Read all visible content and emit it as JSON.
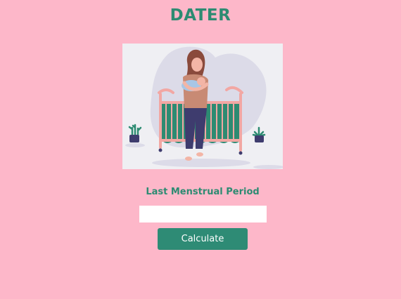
{
  "app": {
    "title": "DATER"
  },
  "form": {
    "lmp_label": "Last Menstrual Period",
    "lmp_value": "",
    "calculate_label": "Calculate"
  },
  "colors": {
    "background": "#fdb7c9",
    "accent": "#2d8b72",
    "button": "#2e8b75"
  },
  "illustration": {
    "subject": "mother-holding-baby-beside-crib"
  }
}
